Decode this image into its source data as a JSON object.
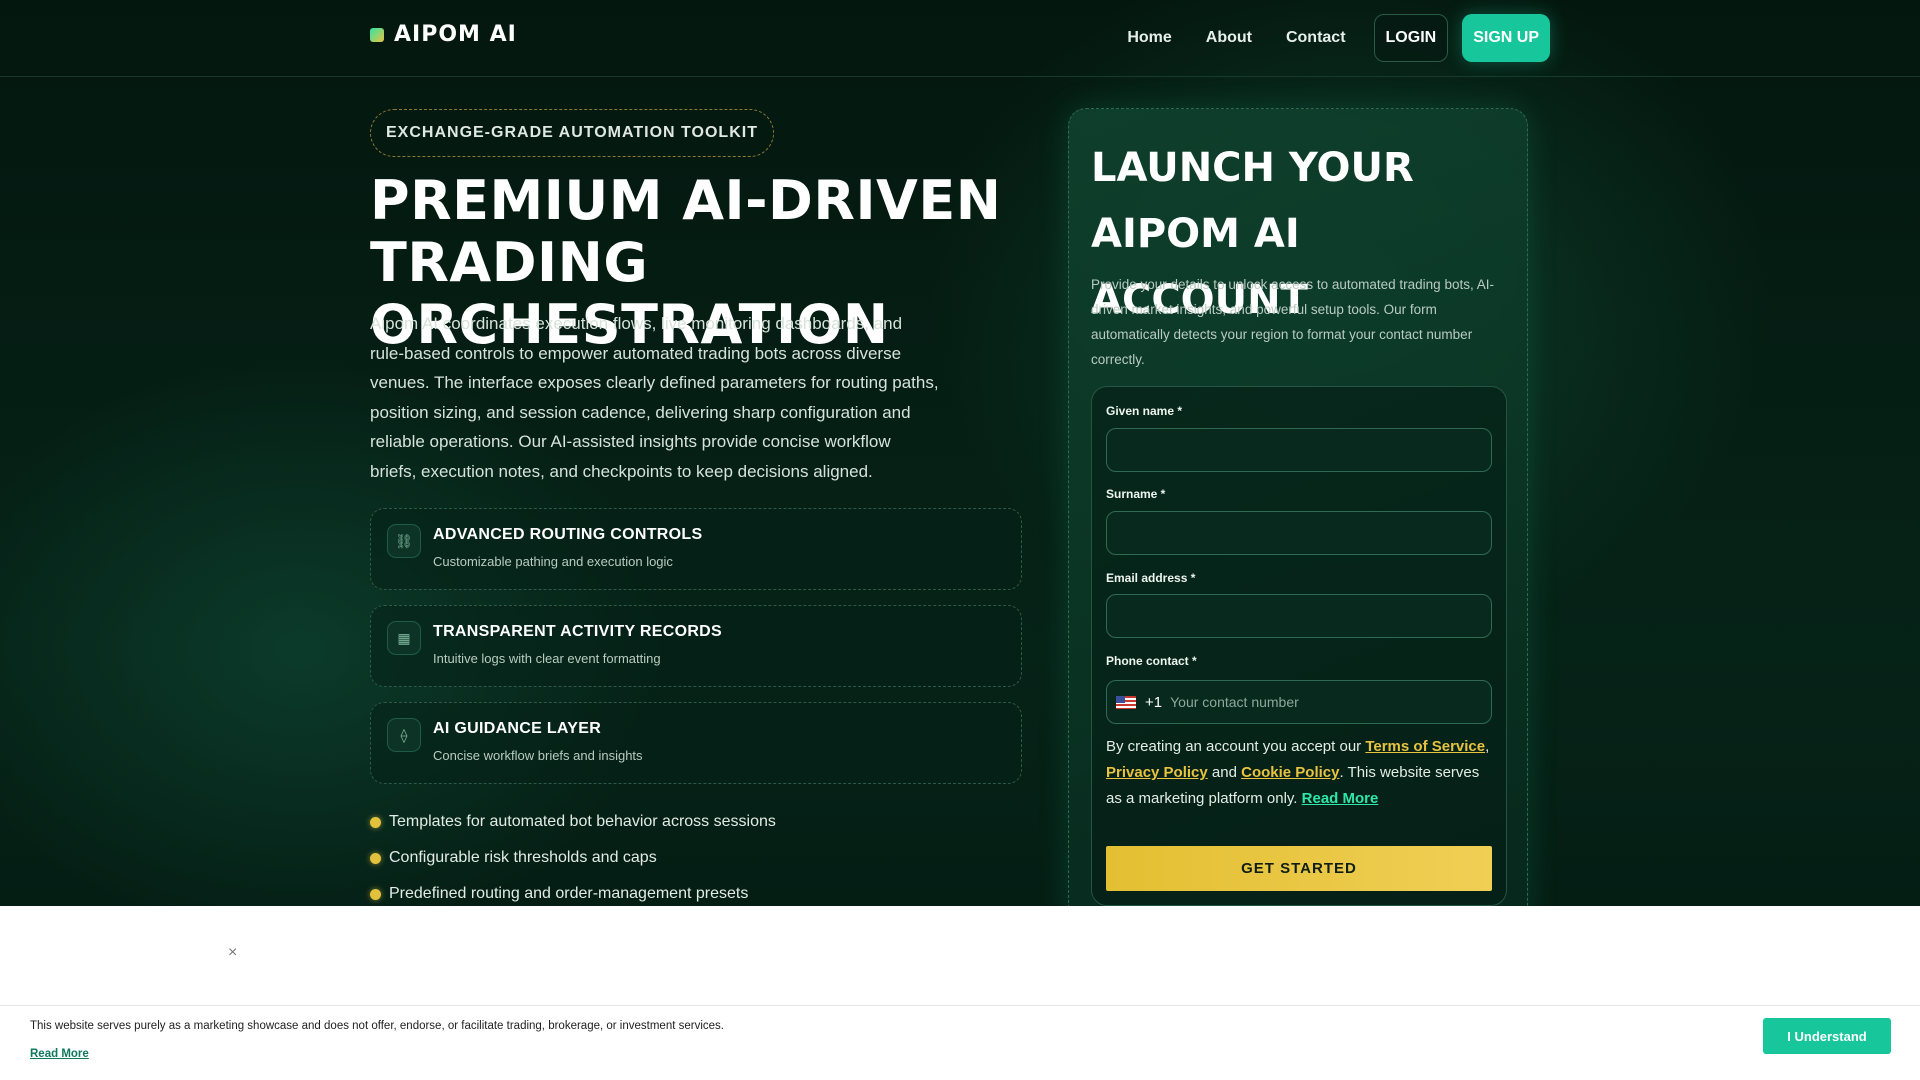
{
  "nav": {
    "logo": "AIPOM AI",
    "links": [
      "Home",
      "About",
      "Contact"
    ],
    "login": "LOGIN",
    "signup": "SIGN UP"
  },
  "hero": {
    "badge": "EXCHANGE-GRADE AUTOMATION TOOLKIT",
    "title": "PREMIUM AI-DRIVEN TRADING ORCHESTRATION",
    "description": "Aipom AI coordinates execution flows, live monitoring dashboards, and rule-based controls to empower automated trading bots across diverse venues. The interface exposes clearly defined parameters for routing paths, position sizing, and session cadence, delivering sharp configuration and reliable operations. Our AI-assisted insights provide concise workflow briefs, execution notes, and checkpoints to keep decisions aligned.",
    "features": [
      {
        "icon": "routing-icon",
        "glyph": "⛓",
        "title": "ADVANCED ROUTING CONTROLS",
        "desc": "Customizable pathing and execution logic"
      },
      {
        "icon": "records-icon",
        "glyph": "▦",
        "title": "TRANSPARENT ACTIVITY RECORDS",
        "desc": "Intuitive logs with clear event formatting"
      },
      {
        "icon": "ai-guidance-icon",
        "glyph": "⟠",
        "title": "AI GUIDANCE LAYER",
        "desc": "Concise workflow briefs and insights"
      }
    ],
    "bullets": [
      "Templates for automated bot behavior across sessions",
      "Configurable risk thresholds and caps",
      "Predefined routing and order-management presets"
    ]
  },
  "form": {
    "title": "LAUNCH YOUR AIPOM AI ACCOUNT",
    "description": "Provide your details to unlock access to automated trading bots, AI-driven market insights, and powerful setup tools. Our form automatically detects your region to format your contact number correctly.",
    "given_name_label": "Given name *",
    "given_name_value": "",
    "surname_label": "Surname *",
    "surname_value": "",
    "email_label": "Email address *",
    "email_value": "",
    "phone_label": "Phone contact *",
    "phone_dial": "+1",
    "phone_placeholder": "Your contact number",
    "terms_prefix": "By creating an account you accept our ",
    "terms_link": "Terms of Service",
    "terms_comma": ",",
    "privacy_link": "Privacy Policy",
    "terms_and": " and ",
    "cookie_link": "Cookie Policy",
    "terms_suffix": ". This website serves as a marketing platform only. ",
    "read_more": "Read More",
    "submit": "GET STARTED"
  },
  "cookie": {
    "close": "×",
    "text": "This website serves purely as a marketing showcase and does not offer, endorse, or facilitate trading, brokerage, or investment services.",
    "read_more": "Read More",
    "accept": "I Understand"
  },
  "colors": {
    "accent_green": "#17c79b",
    "accent_gold": "#e8c340",
    "background": "#03140f"
  }
}
